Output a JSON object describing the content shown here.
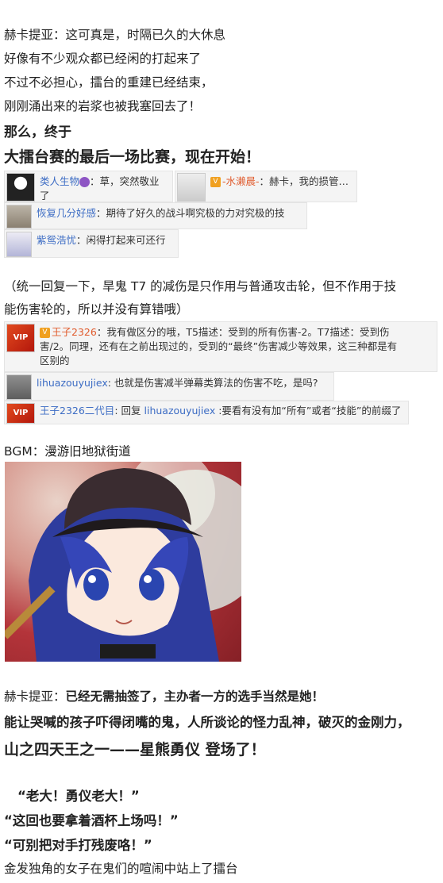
{
  "intro": [
    "赫卡提亚：这可真是，时隔已久的大休息",
    "好像有不少观众都已经闲的打起来了",
    "不过不必担心，擂台的重建已经结束，",
    "刚刚涌出来的岩浆也被我塞回去了！",
    "那么，终于",
    "大擂台赛的最后一场比赛，现在开始！"
  ],
  "comments1": [
    {
      "user": "类人生物",
      "text": "草，突然敬业了"
    },
    {
      "user": "-水濑晨-",
      "text": "赫卡，我的损管…"
    },
    {
      "user": "恢复几分好感",
      "text": "期待了好久的战斗啊究极的力对究极的技"
    },
    {
      "user": "紫鸳浩忧",
      "text": "闲得打起来可还行"
    }
  ],
  "note": [
    "（统一回复一下，旱鬼 T7 的减伤是只作用与普通攻击轮，但不作用于技",
    "能伤害轮的，所以并没有算错哦）"
  ],
  "comments2": [
    {
      "user": "王子2326",
      "lines": [
        "我有做区分的哦，T5描述：受到的所有伤害-2。T7描述：受到伤",
        "害/2。同理，还有在之前出现过的，受到的“最终”伤害减少等效果，这三种都是有",
        "区别的"
      ]
    },
    {
      "user": "lihuazouyujiex",
      "text": "也就是伤害减半弹幕类算法的伤害不吃，是吗?"
    },
    {
      "user": "王子2326二代目",
      "reply_word": "回复",
      "reply_to": "lihuazouyujiex",
      "text": ":要看有没有加“所有”或者“技能”的前缀了"
    }
  ],
  "bgm": "BGM：漫游旧地狱街道",
  "outro": {
    "line1_speaker": "赫卡提亚：",
    "line1_bold": "已经无需抽签了，主办者一方的选手当然是她！",
    "line2": "能让哭喊的孩子吓得闭嘴的鬼，人所谈论的怪力乱神，破灭的金刚力，",
    "line3": "山之四天王之一——星熊勇仪 登场了！",
    "cheers": [
      "“老大！勇仪老大！”",
      "“这回也要拿着酒杯上场吗！”",
      "“可别把对手打残废咯！”"
    ],
    "last": "金发独角的女子在鬼们的喧闹中站上了擂台"
  },
  "colors": {
    "username": "#3c6cc4",
    "username_red": "#e05a2c",
    "comment_bg": "#f4f4f4"
  }
}
